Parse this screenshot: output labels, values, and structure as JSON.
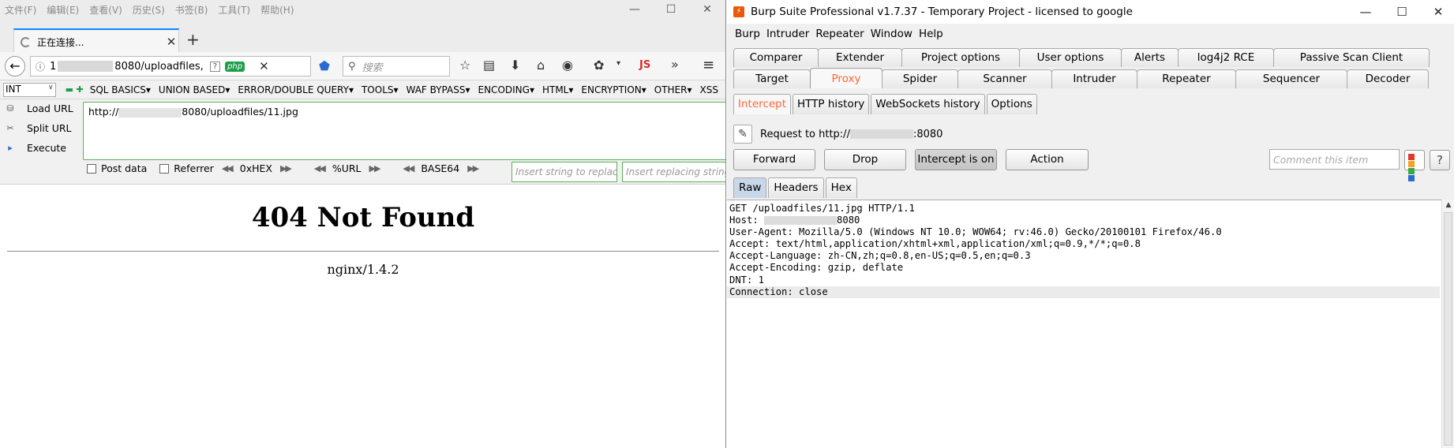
{
  "firefox": {
    "menu": [
      "文件(F)",
      "编辑(E)",
      "查看(V)",
      "历史(S)",
      "书签(B)",
      "工具(T)",
      "帮助(H)"
    ],
    "window_controls": {
      "minimize": "—",
      "maximize": "☐",
      "close": "✕"
    },
    "tab": {
      "title": "正在连接...",
      "close": "✕"
    },
    "new_tab": "+",
    "nav": {
      "back": "←",
      "url_prefix": "1",
      "url_suffix": "8080/uploadfiles,",
      "php_badge": "php",
      "clear": "✕",
      "search_placeholder": "搜索",
      "search_icon": "⚲",
      "js_badge": "JS",
      "more": "»",
      "menu": "≡"
    },
    "hackbar": {
      "select_value": "INT",
      "menus": [
        "SQL BASICS▾",
        "UNION BASED▾",
        "ERROR/DOUBLE QUERY▾",
        "TOOLS▾",
        "WAF BYPASS▾",
        "ENCODING▾",
        "HTML▾",
        "ENCRYPTION▾",
        "OTHER▾",
        "XSS"
      ],
      "actions": [
        "Load URL",
        "Split URL",
        "Execute"
      ],
      "url_prefix": "http://",
      "url_suffix": "8080/uploadfiles/11.jpg",
      "post_data": "Post data",
      "referrer": "Referrer",
      "hex": "0xHEX",
      "url_enc": "%URL",
      "base64": "BASE64",
      "insert_string": "Insert string to replace",
      "insert_replacing": "Insert replacing string"
    },
    "page": {
      "heading": "404 Not Found",
      "server": "nginx/1.4.2"
    }
  },
  "burp": {
    "title": "Burp Suite Professional v1.7.37 - Temporary Project - licensed to google",
    "window_controls": {
      "minimize": "—",
      "maximize": "☐",
      "close": "✕"
    },
    "menu": [
      "Burp",
      "Intruder",
      "Repeater",
      "Window",
      "Help"
    ],
    "tabs_top": [
      "Comparer",
      "Extender",
      "Project options",
      "User options",
      "Alerts",
      "log4j2 RCE",
      "Passive Scan Client"
    ],
    "tabs_bottom": [
      "Target",
      "Proxy",
      "Spider",
      "Scanner",
      "Intruder",
      "Repeater",
      "Sequencer",
      "Decoder"
    ],
    "active_main_tab": "Proxy",
    "proxy_tabs": [
      "Intercept",
      "HTTP history",
      "WebSockets history",
      "Options"
    ],
    "active_proxy_tab": "Intercept",
    "request_prefix": "Request to http://",
    "request_suffix": ":8080",
    "buttons": {
      "forward": "Forward",
      "drop": "Drop",
      "intercept": "Intercept is on",
      "action": "Action"
    },
    "comment_placeholder": "Comment this item",
    "help": "?",
    "view_tabs": [
      "Raw",
      "Headers",
      "Hex"
    ],
    "active_view_tab": "Raw",
    "request_lines": [
      "GET /uploadfiles/11.jpg HTTP/1.1",
      "Host: ",
      "User-Agent: Mozilla/5.0 (Windows NT 10.0; WOW64; rv:46.0) Gecko/20100101 Firefox/46.0",
      "Accept: text/html,application/xhtml+xml,application/xml;q=0.9,*/*;q=0.8",
      "Accept-Language: zh-CN,zh;q=0.8,en-US;q=0.5,en;q=0.3",
      "Accept-Encoding: gzip, deflate",
      "DNT: 1",
      "Connection: close"
    ],
    "host_suffix": "8080",
    "accent_color": "#ff6633"
  }
}
